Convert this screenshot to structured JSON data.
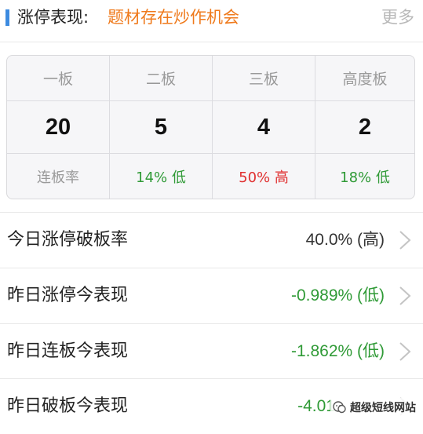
{
  "header": {
    "title": "涨停表现:",
    "subtitle": "题材存在炒作机会",
    "more_label": "更多",
    "accent_color": "#3d8be0"
  },
  "board_table": {
    "columns": [
      {
        "label": "一板",
        "count": "20",
        "rate": "连板率",
        "rate_color": "grey"
      },
      {
        "label": "二板",
        "count": "5",
        "rate": "14% 低",
        "rate_color": "green"
      },
      {
        "label": "三板",
        "count": "4",
        "rate": "50% 高",
        "rate_color": "red"
      },
      {
        "label": "高度板",
        "count": "2",
        "rate": "18% 低",
        "rate_color": "green"
      }
    ]
  },
  "rows": [
    {
      "label": "今日涨停破板率",
      "value": "40.0% (高)",
      "value_color": "#333333"
    },
    {
      "label": "昨日涨停今表现",
      "value": "-0.989% (低)",
      "value_color": "#2f9a36"
    },
    {
      "label": "昨日连板今表现",
      "value": "-1.862% (低)",
      "value_color": "#2f9a36"
    },
    {
      "label": "昨日破板今表现",
      "value": "-4.01",
      "value_color": "#2f9a36"
    }
  ],
  "watermark": {
    "text": "超级短线网站",
    "icon": "wechat-icon"
  },
  "icons": {
    "row_arrow": "chevron-right-icon"
  }
}
